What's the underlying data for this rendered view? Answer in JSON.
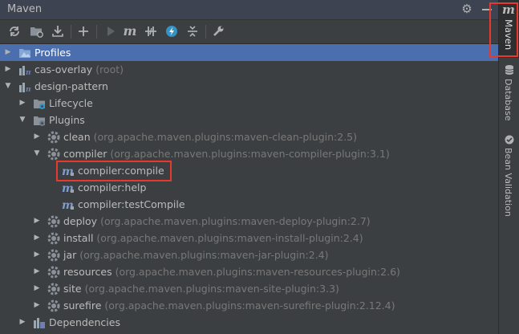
{
  "window": {
    "title": "Maven"
  },
  "toolbar": {
    "buttons": [
      {
        "name": "reimport-icon"
      },
      {
        "name": "generate-sources-icon"
      },
      {
        "name": "download-icon"
      },
      {
        "name": "add-icon"
      },
      {
        "name": "run-icon"
      },
      {
        "name": "execute-goal-icon"
      },
      {
        "name": "toggle-offline-icon"
      },
      {
        "name": "skip-tests-icon"
      },
      {
        "name": "collapse-all-icon"
      },
      {
        "name": "settings-wrench-icon"
      }
    ]
  },
  "tree": {
    "profiles": "Profiles",
    "cas_overlay": {
      "name": "cas-overlay",
      "suffix": "(root)"
    },
    "design_pattern": "design-pattern",
    "lifecycle": "Lifecycle",
    "plugins": "Plugins",
    "clean": {
      "name": "clean",
      "suffix": "(org.apache.maven.plugins:maven-clean-plugin:2.5)"
    },
    "compiler": {
      "name": "compiler",
      "suffix": "(org.apache.maven.plugins:maven-compiler-plugin:3.1)"
    },
    "goals": [
      "compiler:compile",
      "compiler:help",
      "compiler:testCompile"
    ],
    "deploy": {
      "name": "deploy",
      "suffix": "(org.apache.maven.plugins:maven-deploy-plugin:2.7)"
    },
    "install": {
      "name": "install",
      "suffix": "(org.apache.maven.plugins:maven-install-plugin:2.4)"
    },
    "jar": {
      "name": "jar",
      "suffix": "(org.apache.maven.plugins:maven-jar-plugin:2.4)"
    },
    "resources": {
      "name": "resources",
      "suffix": "(org.apache.maven.plugins:maven-resources-plugin:2.6)"
    },
    "site": {
      "name": "site",
      "suffix": "(org.apache.maven.plugins:maven-site-plugin:3.3)"
    },
    "surefire": {
      "name": "surefire",
      "suffix": "(org.apache.maven.plugins:maven-surefire-plugin:2.12.4)"
    },
    "dependencies": "Dependencies"
  },
  "sidebar": {
    "maven_icon": "m",
    "tabs": [
      "Maven",
      "Database",
      "Bean Validation"
    ]
  },
  "colors": {
    "background": "#3c3f41",
    "selection": "#4b6eaf",
    "highlight": "#e8392f",
    "secondary_text": "#787878"
  }
}
